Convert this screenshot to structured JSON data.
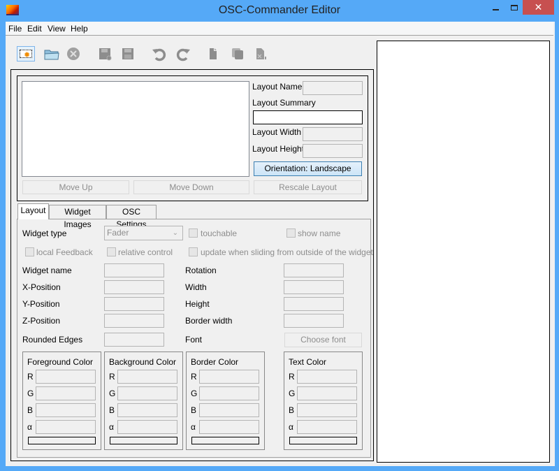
{
  "window": {
    "title": "OSC-Commander Editor",
    "close_glyph": "✕"
  },
  "menu": [
    "File",
    "Edit",
    "View",
    "Help"
  ],
  "toolbar": [
    {
      "name": "new-layout-icon",
      "enabled": true
    },
    {
      "name": "open-folder-icon",
      "enabled": true
    },
    {
      "name": "delete-circle-icon",
      "enabled": false
    },
    {
      "name": "save-as-icon",
      "enabled": false
    },
    {
      "name": "save-icon",
      "enabled": false
    },
    {
      "name": "undo-icon",
      "enabled": false
    },
    {
      "name": "redo-icon",
      "enabled": false
    },
    {
      "name": "copy-icon",
      "enabled": false
    },
    {
      "name": "duplicate-icon",
      "enabled": false
    },
    {
      "name": "remove-page-icon",
      "enabled": false
    }
  ],
  "layout_props": {
    "name_label": "Layout Name",
    "summary_label": "Layout Summary",
    "width_label": "Layout Width",
    "height_label": "Layout Height",
    "name_value": "",
    "summary_value": "",
    "width_value": "",
    "height_value": "",
    "orientation_button": "Orientation: Landscape",
    "move_up": "Move Up",
    "move_down": "Move Down",
    "rescale": "Rescale Layout"
  },
  "tabs": [
    "Layout",
    "Widget Images",
    "OSC Settings"
  ],
  "active_tab": "Layout",
  "widget": {
    "type_label": "Widget type",
    "type_value": "Fader",
    "touchable": "touchable",
    "show_name": "show name",
    "local_feedback": "local Feedback",
    "relative_control": "relative control",
    "update_sliding": "update when sliding from outside of the widget",
    "name_label": "Widget name",
    "x_label": "X-Position",
    "y_label": "Y-Position",
    "z_label": "Z-Position",
    "rounded_label": "Rounded Edges",
    "rotation_label": "Rotation",
    "width_label": "Width",
    "height_label": "Height",
    "border_width_label": "Border width",
    "font_label": "Font",
    "choose_font": "Choose font"
  },
  "color_groups": [
    {
      "title": "Foreground Color",
      "channels": [
        "R",
        "G",
        "B",
        "α"
      ]
    },
    {
      "title": "Background Color",
      "channels": [
        "R",
        "G",
        "B",
        "α"
      ]
    },
    {
      "title": "Border Color",
      "channels": [
        "R",
        "G",
        "B",
        "α"
      ]
    },
    {
      "title": "Text Color",
      "channels": [
        "R",
        "G",
        "B",
        "α"
      ]
    }
  ]
}
